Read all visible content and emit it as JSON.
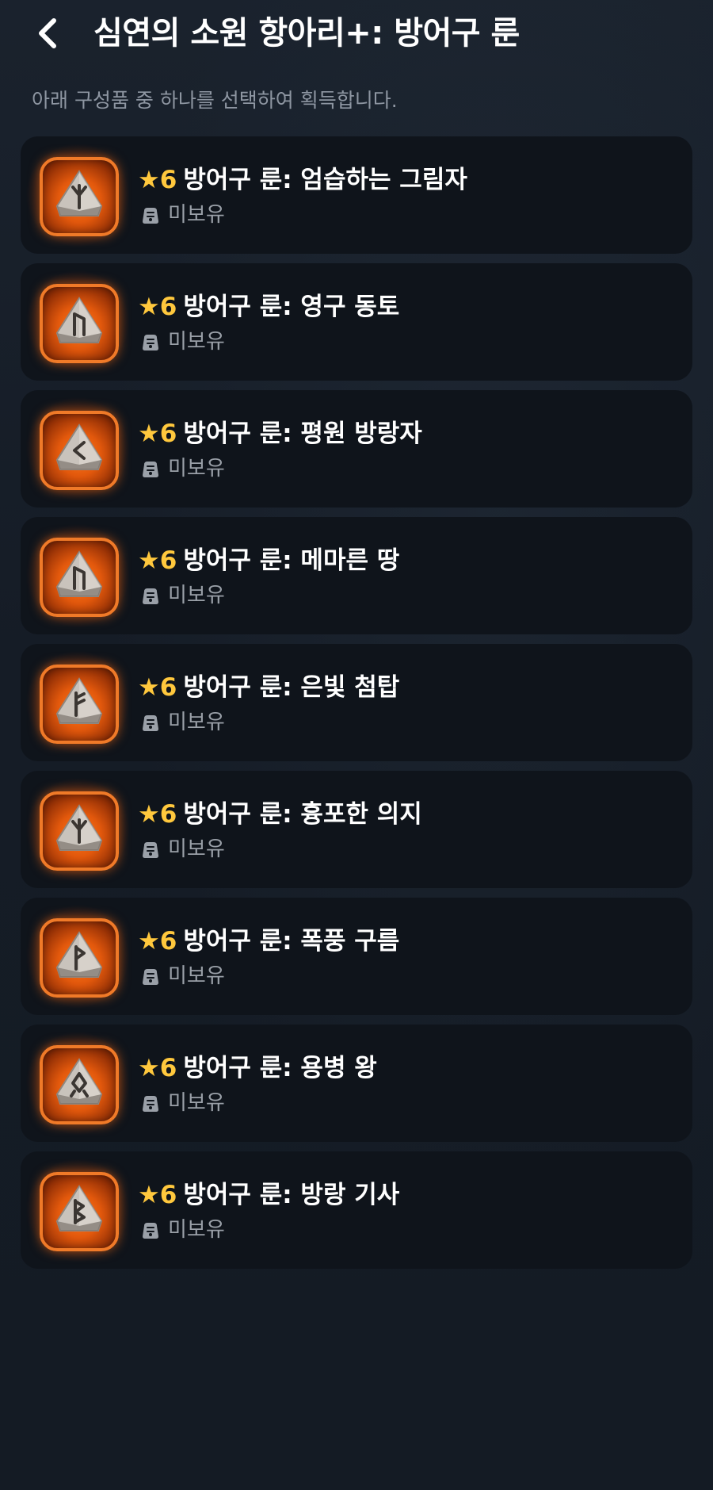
{
  "header": {
    "title": "심연의 소원 항아리+: 방어구 룬",
    "subtitle": "아래 구성품 중 하나를 선택하여 획득합니다."
  },
  "colors": {
    "background": "#151c26",
    "card": "#0f141b",
    "star": "#ffc83d",
    "rune_frame": "#f07a28",
    "muted_text": "#8e96a2"
  },
  "items": [
    {
      "grade": "★6",
      "name": "방어구 룬: 엄습하는 그림자",
      "status": "미보유",
      "rune_icon": "rune-algiz-icon"
    },
    {
      "grade": "★6",
      "name": "방어구 룬: 영구 동토",
      "status": "미보유",
      "rune_icon": "rune-uruz-icon"
    },
    {
      "grade": "★6",
      "name": "방어구 룬: 평원 방랑자",
      "status": "미보유",
      "rune_icon": "rune-kenaz-icon"
    },
    {
      "grade": "★6",
      "name": "방어구 룬: 메마른 땅",
      "status": "미보유",
      "rune_icon": "rune-uruz-icon"
    },
    {
      "grade": "★6",
      "name": "방어구 룬: 은빛 첨탑",
      "status": "미보유",
      "rune_icon": "rune-fehu-icon"
    },
    {
      "grade": "★6",
      "name": "방어구 룬: 흉포한 의지",
      "status": "미보유",
      "rune_icon": "rune-algiz-icon"
    },
    {
      "grade": "★6",
      "name": "방어구 룬: 폭풍 구름",
      "status": "미보유",
      "rune_icon": "rune-wunjo-icon"
    },
    {
      "grade": "★6",
      "name": "방어구 룬: 용병 왕",
      "status": "미보유",
      "rune_icon": "rune-othala-icon"
    },
    {
      "grade": "★6",
      "name": "방어구 룬: 방랑 기사",
      "status": "미보유",
      "rune_icon": "rune-berkano-icon"
    }
  ]
}
